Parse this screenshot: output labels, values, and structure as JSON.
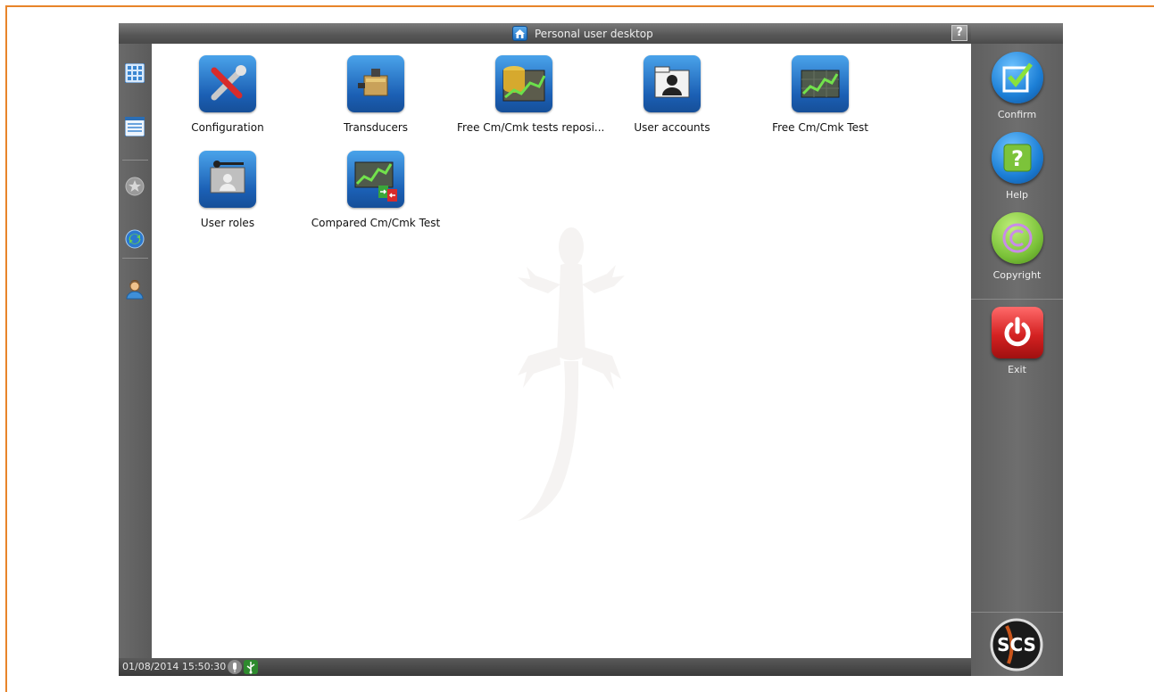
{
  "window": {
    "title": "Personal user desktop",
    "help_glyph": "?"
  },
  "left_toolbar": {
    "items": [
      {
        "name": "grid-view",
        "icon": "grid-icon"
      },
      {
        "name": "list-view",
        "icon": "list-icon"
      },
      {
        "name": "favorites",
        "icon": "star-icon"
      },
      {
        "name": "recycle",
        "icon": "recycle-icon"
      },
      {
        "name": "user",
        "icon": "user-icon"
      }
    ]
  },
  "desktop": {
    "tiles": [
      {
        "label": "Configuration",
        "icon": "tools-icon"
      },
      {
        "label": "Transducers",
        "icon": "transducer-icon"
      },
      {
        "label": "Free Cm/Cmk tests reposi...",
        "icon": "repository-chart-icon"
      },
      {
        "label": "User accounts",
        "icon": "user-accounts-icon"
      },
      {
        "label": "Free Cm/Cmk Test",
        "icon": "chart-icon"
      },
      {
        "label": "User roles",
        "icon": "user-roles-icon"
      },
      {
        "label": "Compared Cm/Cmk Test",
        "icon": "compared-chart-icon"
      }
    ]
  },
  "right_panel": {
    "confirm_label": "Confirm",
    "help_label": "Help",
    "copyright_label": "Copyright",
    "exit_label": "Exit",
    "logo_text": "SCS"
  },
  "status": {
    "datetime": "01/08/2014 15:50:30"
  },
  "colors": {
    "frame_accent": "#e8842a",
    "tile_blue": "#1b5fb4",
    "confirm_blue": "#1c7fd6",
    "copyright_green": "#7cc33a",
    "exit_red": "#d42222"
  }
}
